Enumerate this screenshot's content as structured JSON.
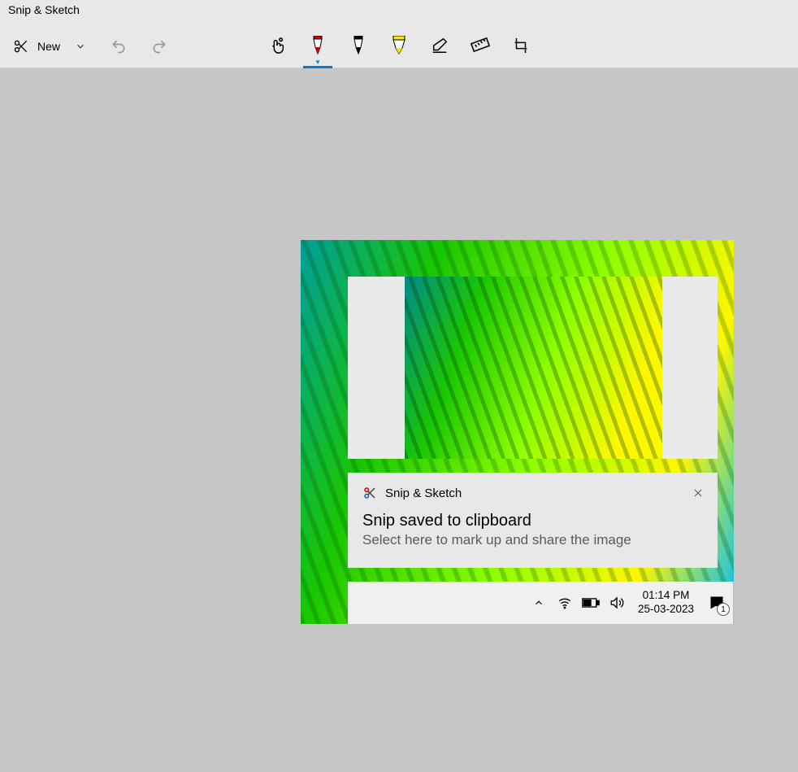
{
  "window": {
    "title": "Snip & Sketch"
  },
  "toolbar": {
    "new_label": "New",
    "tools": {
      "touch": "touch-writing-icon",
      "ballpoint": "ballpoint-pen-icon",
      "pencil": "pencil-icon",
      "highlighter": "highlighter-icon",
      "eraser": "eraser-icon",
      "ruler": "ruler-icon",
      "crop": "crop-icon"
    }
  },
  "notification": {
    "app_name": "Snip & Sketch",
    "headline": "Snip saved to clipboard",
    "subtext": "Select here to mark up and share the image"
  },
  "tray": {
    "time": "01:14 PM",
    "date": "25-03-2023",
    "badge": "1"
  }
}
